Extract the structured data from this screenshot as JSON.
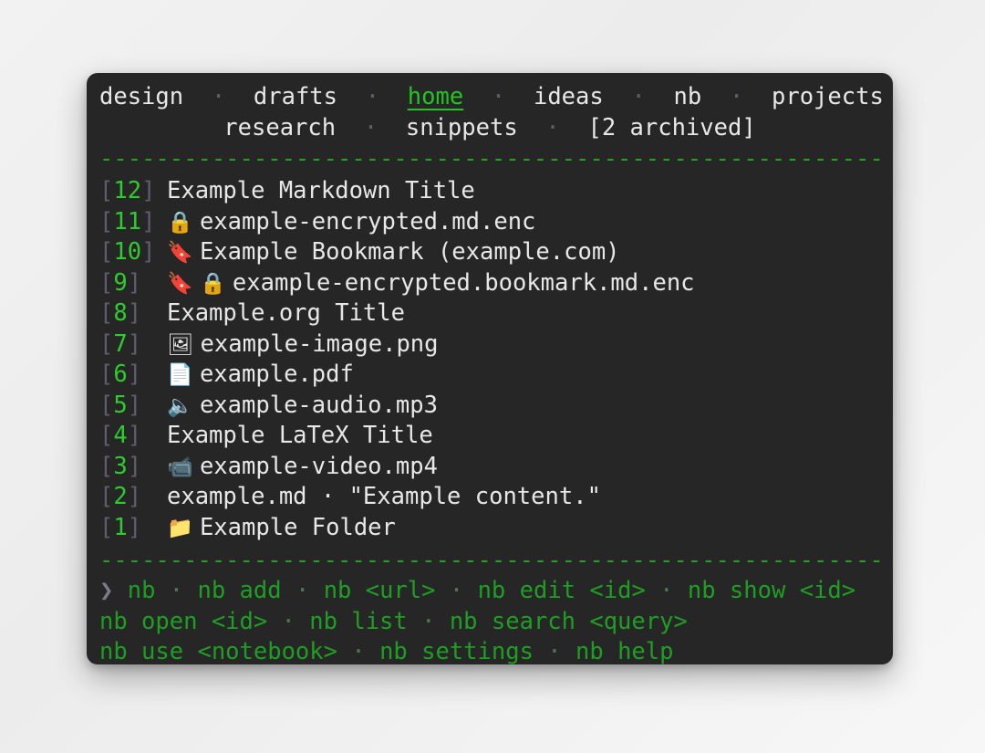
{
  "window": {
    "background_color": "#262626",
    "accent_color": "#2ecc2e",
    "dim_color": "#5d5d6e"
  },
  "header": {
    "notebooks_line_1": [
      {
        "label": "design",
        "current": false
      },
      {
        "label": "drafts",
        "current": false
      },
      {
        "label": "home",
        "current": true
      },
      {
        "label": "ideas",
        "current": false
      },
      {
        "label": "nb",
        "current": false
      },
      {
        "label": "projects",
        "current": false
      }
    ],
    "notebooks_line_2": [
      {
        "label": "research",
        "current": false
      },
      {
        "label": "snippets",
        "current": false
      },
      {
        "label": "[2 archived]",
        "current": false
      }
    ],
    "separator_dot": "·",
    "rule": "--------------------------------------------------------------------------"
  },
  "items": [
    {
      "id": "12",
      "icon": "",
      "icon_name": "none",
      "title": "Example Markdown Title"
    },
    {
      "id": "11",
      "icon": "🔒",
      "icon_name": "lock-icon",
      "title": "example-encrypted.md.enc"
    },
    {
      "id": "10",
      "icon": "🔖",
      "icon_name": "bookmark-icon",
      "title": "Example Bookmark (example.com)"
    },
    {
      "id": "9",
      "icon": "🔖 🔒",
      "icon_name": "bookmark-lock-icon",
      "title": "example-encrypted.bookmark.md.enc"
    },
    {
      "id": "8",
      "icon": "",
      "icon_name": "none",
      "title": "Example.org Title"
    },
    {
      "id": "7",
      "icon": "🖼",
      "icon_name": "image-icon",
      "title": "example-image.png"
    },
    {
      "id": "6",
      "icon": "📄",
      "icon_name": "document-icon",
      "title": "example.pdf"
    },
    {
      "id": "5",
      "icon": "🔈",
      "icon_name": "speaker-icon",
      "title": "example-audio.mp3"
    },
    {
      "id": "4",
      "icon": "",
      "icon_name": "none",
      "title": "Example LaTeX Title"
    },
    {
      "id": "3",
      "icon": "📹",
      "icon_name": "video-camera-icon",
      "title": "example-video.mp4"
    },
    {
      "id": "2",
      "icon": "",
      "icon_name": "none",
      "title": "example.md · \"Example content.\""
    },
    {
      "id": "1",
      "icon": "📁",
      "icon_name": "folder-icon",
      "title": "Example Folder"
    }
  ],
  "footer": {
    "rule": "--------------------------------------------------------------------------",
    "prompt": "❯",
    "separator": "·",
    "lines": [
      [
        "nb",
        "nb add",
        "nb <url>",
        "nb edit <id>",
        "nb show <id>"
      ],
      [
        "nb open <id>",
        "nb list",
        "nb search <query>"
      ],
      [
        "nb use <notebook>",
        "nb settings",
        "nb help"
      ]
    ]
  }
}
